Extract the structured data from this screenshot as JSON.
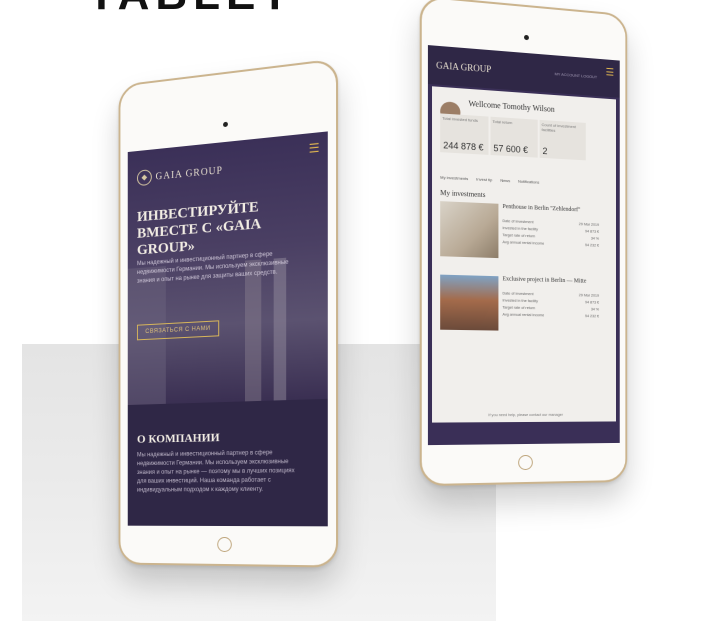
{
  "headline": "TABLET",
  "left_tablet": {
    "logo": "GAIA GROUP",
    "hero_title": "ИНВЕСТИРУЙТЕ ВМЕСТЕ С «GAIA GROUP»",
    "hero_text": "Мы надежный и инвестиционный партнер в сфере недвижимости Германии. Мы используем эксклюзивные знания и опыт на рынке для защиты ваших средств.",
    "cta": "СВЯЗАТЬСЯ С НАМИ",
    "about_title": "О КОМПАНИИ",
    "about_text": "Мы надежный и инвестиционный партнер в сфере недвижимости Германии. Мы используем эксклюзивные знания и опыт на рынке — поэтому мы в лучших позициях для ваших инвестиций. Наша команда работает с индивидуальным подходом к каждому клиенту."
  },
  "right_tablet": {
    "logo": "GAIA GROUP",
    "nav": "MY ACCOUNT   LOGOUT",
    "welcome": "Wellcome Tomothy Wilson",
    "stats": [
      {
        "label": "Total invested funds",
        "value": "244 878 €"
      },
      {
        "label": "Total return",
        "value": "57 600 €"
      },
      {
        "label": "Count of investment facilities",
        "value": "2"
      }
    ],
    "tabs": [
      "My investments",
      "Invest tip",
      "News",
      "Notifications"
    ],
    "section_title": "My investments",
    "cards": [
      {
        "title": "Penthouse in Berlin \"Zehlendorf\"",
        "rows": [
          [
            "Date of investment",
            "29 Mar 2019"
          ],
          [
            "Invested in the facility",
            "94 873 €"
          ],
          [
            "Target rate of return",
            "34 %"
          ],
          [
            "Avg annual rental income",
            "54 232 €"
          ]
        ]
      },
      {
        "title": "Exclusive project in Berlin — Mitte",
        "rows": [
          [
            "Date of investment",
            "29 Mar 2019"
          ],
          [
            "Invested in the facility",
            "94 873 €"
          ],
          [
            "Target rate of return",
            "34 %"
          ],
          [
            "Avg annual rental income",
            "54 232 €"
          ]
        ]
      }
    ],
    "footer": "If you need help, please contact our manager"
  }
}
